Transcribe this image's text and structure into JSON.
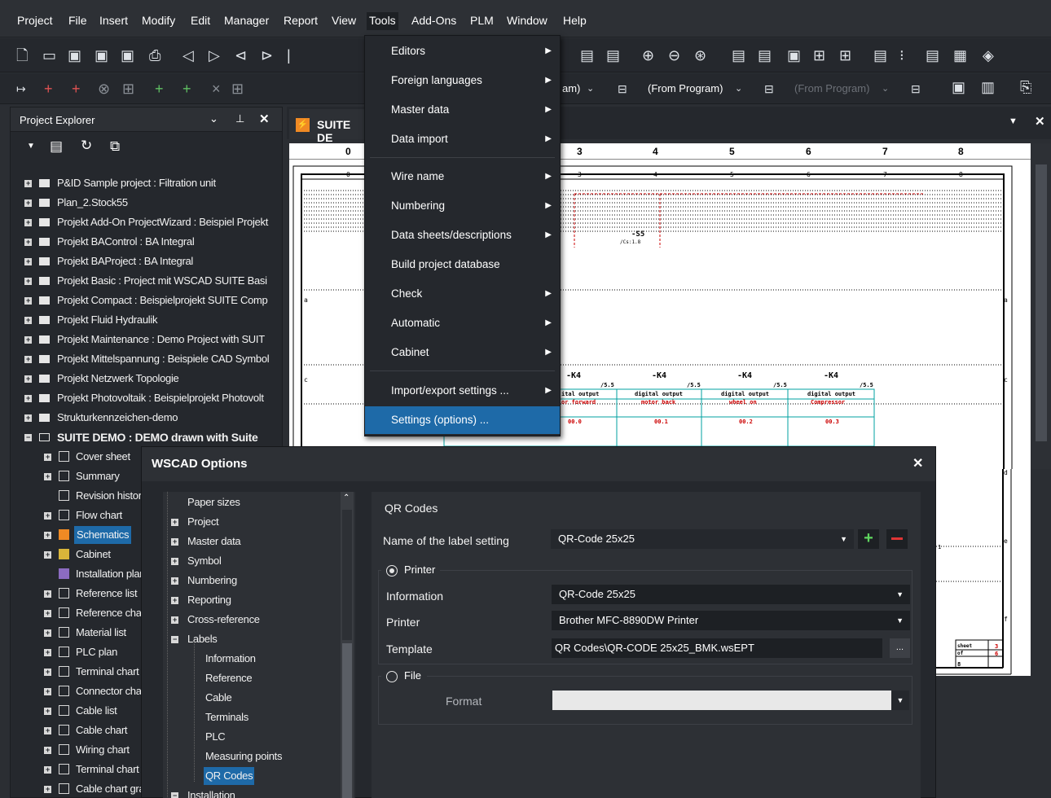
{
  "menubar": {
    "items": [
      "Project",
      "File",
      "Insert",
      "Modify",
      "Edit",
      "Manager",
      "Report",
      "View",
      "Tools",
      "Add-Ons",
      "PLM",
      "Window",
      "Help"
    ],
    "active": "Tools"
  },
  "toolbar2": {
    "program_select_1": "am)",
    "program_select_2": "(From Program)",
    "program_select_3": "(From Program)"
  },
  "explorer": {
    "title": "Project Explorer",
    "items": [
      "P&ID Sample project : Filtration unit",
      "Plan_2.Stock55",
      "Projekt Add-On ProjectWizard : Beispiel Projekt",
      "Projekt BAControl : BA Integral",
      "Projekt BAProject : BA Integral",
      "Projekt Basic : Project mit WSCAD SUITE Basi",
      "Projekt Compact : Beispielprojekt SUITE Comp",
      "Projekt Fluid Hydraulik",
      "Projekt Maintenance : Demo Project with SUIT",
      "Projekt Mittelspannung : Beispiele CAD Symbol",
      "Projekt Netzwerk Topologie",
      "Projekt Photovoltaik : Beispielprojekt Photovolt",
      "Strukturkennzeichen-demo",
      "SUITE DEMO : DEMO drawn with Suite"
    ],
    "children": [
      "Cover sheet",
      "Summary",
      "Revision history",
      "Flow chart",
      "Schematics",
      "Cabinet",
      "Installation plan",
      "Reference list",
      "Reference char",
      "Material list",
      "PLC plan",
      "Terminal chart",
      "Connector char",
      "Cable list",
      "Cable chart",
      "Wiring chart",
      "Terminal chart g",
      "Cable chart gra"
    ],
    "selected_child": "Schematics"
  },
  "doc_tab": {
    "label": "SUITE DE"
  },
  "drawing": {
    "ruler_numbers": [
      "0",
      "3",
      "4",
      "5",
      "6",
      "7",
      "8"
    ],
    "frame_numbers": [
      "0",
      "3",
      "4",
      "5",
      "6",
      "7",
      "8"
    ],
    "row_letters": [
      "a",
      "b",
      "c",
      "d",
      "e",
      "f"
    ],
    "k4_labels": [
      "-K4",
      "-K4",
      "-K4",
      "-K4"
    ],
    "k4_refs": [
      "/5.5",
      "/5.5",
      "/5.5",
      "/5.5"
    ],
    "cell_headers": [
      "ital output",
      "digital output",
      "digital output",
      "digital output"
    ],
    "cell_names": [
      "or forward",
      "motor back",
      "wheel on",
      "Compressor"
    ],
    "cell_addrs": [
      "00.0",
      "00.1",
      "00.2",
      "00.3"
    ],
    "s5_label": "-S5",
    "s5_ref": "/Cs:1.8",
    "sheet_label": "sheet",
    "sheet_val": "3",
    "of_label": "of",
    "of_val": "6",
    "bottom_num": "8",
    "marker_right": "1"
  },
  "tools_menu": {
    "items": [
      {
        "label": "Editors",
        "submenu": true
      },
      {
        "label": "Foreign languages",
        "submenu": true
      },
      {
        "label": "Master data",
        "submenu": true
      },
      {
        "label": "Data import",
        "submenu": true
      },
      {
        "label": "Wire name",
        "submenu": true
      },
      {
        "label": "Numbering",
        "submenu": true
      },
      {
        "label": "Data sheets/descriptions",
        "submenu": true
      },
      {
        "label": "Build project database",
        "submenu": false
      },
      {
        "label": "Check",
        "submenu": true
      },
      {
        "label": "Automatic",
        "submenu": true
      },
      {
        "label": "Cabinet",
        "submenu": true
      },
      {
        "label": "Import/export settings ...",
        "submenu": true
      },
      {
        "label": "Settings (options) ...",
        "submenu": false
      }
    ],
    "highlighted": "Settings (options) ..."
  },
  "dialog": {
    "title": "WSCAD Options",
    "tree": [
      {
        "label": "Paper sizes",
        "level": 1,
        "expander": ""
      },
      {
        "label": "Project",
        "level": 1,
        "expander": "+"
      },
      {
        "label": "Master data",
        "level": 1,
        "expander": "+"
      },
      {
        "label": "Symbol",
        "level": 1,
        "expander": "+"
      },
      {
        "label": "Numbering",
        "level": 1,
        "expander": "+"
      },
      {
        "label": "Reporting",
        "level": 1,
        "expander": "+"
      },
      {
        "label": "Cross-reference",
        "level": 1,
        "expander": "+"
      },
      {
        "label": "Labels",
        "level": 1,
        "expander": "-"
      },
      {
        "label": "Information",
        "level": 2,
        "expander": ""
      },
      {
        "label": "Reference",
        "level": 2,
        "expander": ""
      },
      {
        "label": "Cable",
        "level": 2,
        "expander": ""
      },
      {
        "label": "Terminals",
        "level": 2,
        "expander": ""
      },
      {
        "label": "PLC",
        "level": 2,
        "expander": ""
      },
      {
        "label": "Measuring points",
        "level": 2,
        "expander": ""
      },
      {
        "label": "QR Codes",
        "level": 2,
        "expander": ""
      },
      {
        "label": "Installation",
        "level": 1,
        "expander": "-"
      }
    ],
    "selected": "QR Codes",
    "panel": {
      "heading": "QR Codes",
      "label_setting_label": "Name of the label setting",
      "label_setting_value": "QR-Code 25x25",
      "printer_radio": "Printer",
      "information_label": "Information",
      "information_value": "QR-Code 25x25",
      "printer_label": "Printer",
      "printer_value": "Brother MFC-8890DW Printer",
      "template_label": "Template",
      "template_value": "QR Codes\\QR-CODE 25x25_BMK.wsEPT",
      "browse_label": "...",
      "file_radio": "File",
      "format_label": "Format",
      "format_value": ""
    }
  }
}
